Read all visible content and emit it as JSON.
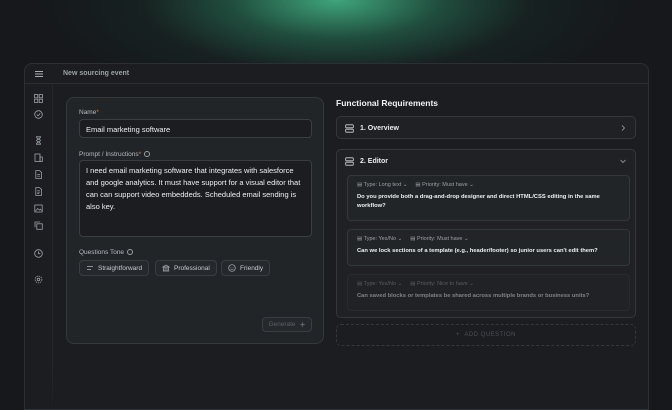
{
  "window": {
    "title": "New sourcing event"
  },
  "sidebar": {
    "icons": [
      "layout-icon",
      "check-circle-icon",
      "hourglass-icon",
      "building-icon",
      "file-icon",
      "document-icon",
      "image-icon",
      "copy-icon",
      "clock-icon",
      "settings-icon"
    ]
  },
  "form": {
    "name_label": "Name",
    "name_value": "Email marketing software",
    "prompt_label": "Prompt / Instructions",
    "prompt_value": "I need email marketing software that integrates with salesforce and google analytics. It must have support for a visual editor that can can support video embeddeds. Scheduled email sending is also key.",
    "tone_label": "Questions Tone",
    "tones": [
      "Straightforward",
      "Professional",
      "Friendly"
    ],
    "generate_label": "Generate"
  },
  "requirements": {
    "title": "Functional Requirements",
    "sections": [
      {
        "label": "1. Overview",
        "expanded": false
      },
      {
        "label": "2. Editor",
        "expanded": true
      }
    ],
    "questions": [
      {
        "type": "Type: Long text",
        "priority": "Priority: Must have",
        "text": "Do you provide both a drag-and-drop designer and direct HTML/CSS editing in the same workflow?"
      },
      {
        "type": "Type: Yes/No",
        "priority": "Priority: Must have",
        "text": "Can we lock sections of a template (e.g., header/footer) so junior users can't edit them?"
      },
      {
        "type": "Type: Yes/No",
        "priority": "Priority: Nice to have",
        "text": "Can saved blocks or templates be shared across multiple brands or business units?"
      }
    ],
    "add_question": "ADD QUESTION"
  },
  "colors": {
    "accent_glow": "#46be8c",
    "required_star": "#e0753f"
  }
}
